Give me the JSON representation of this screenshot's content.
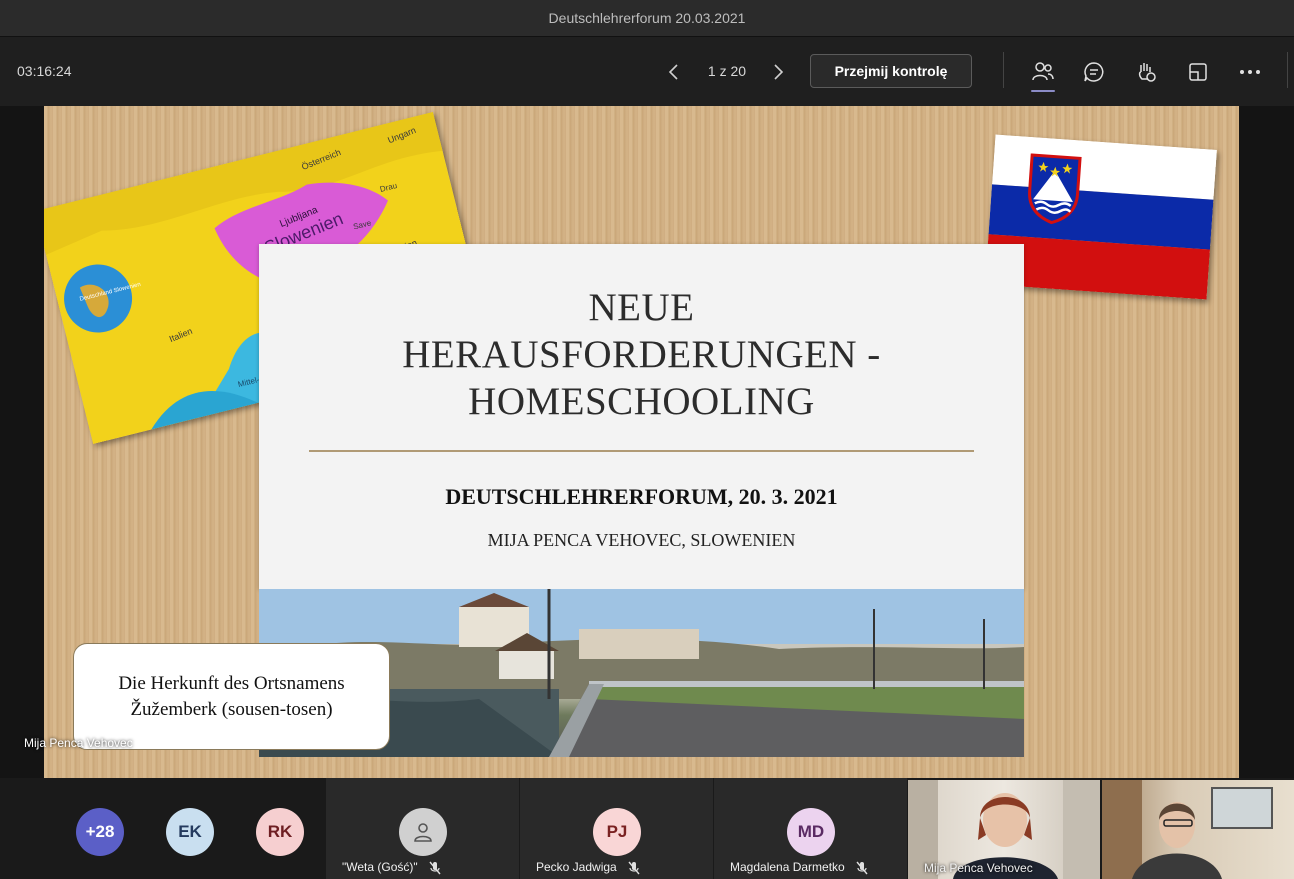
{
  "window": {
    "title": "Deutschlehrerforum 20.03.2021"
  },
  "toolbar": {
    "timer": "03:16:24",
    "page_indicator": "1 z 20",
    "take_control_label": "Przejmij kontrolę",
    "icons": [
      "people-icon",
      "chat-icon",
      "raise-hand-icon",
      "share-tray-icon",
      "more-icon"
    ]
  },
  "slide": {
    "title_line1": "NEUE",
    "title_line2": "HERAUSFORDERUNGEN -",
    "title_line3": "HOMESCHOOLING",
    "subtitle": "DEUTSCHLEHRERFORUM, 20. 3. 2021",
    "author": "MIJA PENCA VEHOVEC, SLOWENIEN",
    "map": {
      "country": "Slowenien",
      "city": "Ljubljana",
      "neighbors": [
        "Österreich",
        "Ungarn",
        "Kroatien",
        "Italien"
      ],
      "labels": [
        "Drau",
        "Save",
        "Mittel-meer",
        "Deutschland Slowenien"
      ]
    },
    "caption_line1": "Die Herkunft des Ortsnamens",
    "caption_line2": "Žužemberk (sousen-tosen)"
  },
  "presenter_label": "Mija Penca Vehovec",
  "participants": {
    "overflow_count": "+28",
    "avatars": [
      {
        "initials": "EK",
        "bg": "#c9dff0",
        "fg": "#243a5e"
      },
      {
        "initials": "RK",
        "bg": "#f6cfd0",
        "fg": "#6e1e22"
      }
    ],
    "tiles": [
      {
        "name": "\"Weta (Gość)\"",
        "initials": "",
        "muted": true
      },
      {
        "name": "Pecko Jadwiga",
        "initials": "PJ",
        "muted": true
      },
      {
        "name": "Magdalena Darmetko",
        "initials": "MD",
        "muted": true
      }
    ],
    "video_tiles": [
      {
        "name": "Mija Penca Vehovec"
      },
      {
        "name": ""
      }
    ]
  },
  "colors": {
    "accent": "#8b8cc7",
    "overflow_bg": "#5b5fc7",
    "flag_blue": "#0b2aa8",
    "flag_red": "#d20f0f"
  }
}
